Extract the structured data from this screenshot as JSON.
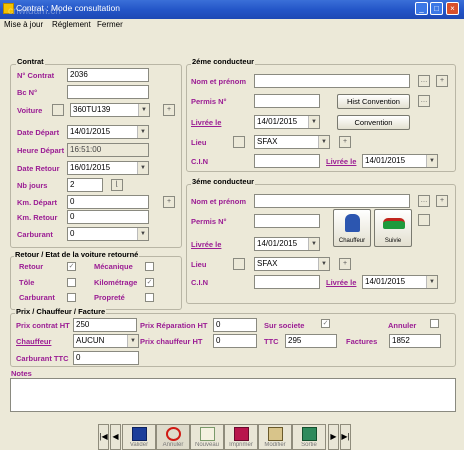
{
  "window": {
    "title": "Contrat : Mode consultation",
    "watermark": "cnwidam.ch"
  },
  "menu": [
    "Mise à jour",
    "Réglement",
    "Fermer"
  ],
  "contrat": {
    "title": "Contrat",
    "labels": {
      "n_contrat": "N° Contrat",
      "bc": "Bc N°",
      "voiture": "Voiture",
      "date_depart": "Date Départ",
      "heure_depart": "Heure Départ",
      "date_retour": "Date Retour",
      "nb_jours": "Nb jours",
      "km_depart": "Km. Départ",
      "km_retour": "Km. Retour",
      "carburant": "Carburant"
    },
    "values": {
      "n_contrat": "2036",
      "bc": "",
      "voiture": "360TU139",
      "date_depart": "14/01/2015",
      "heure_depart": "16:51:00",
      "date_retour": "16/01/2015",
      "nb_jours": "2",
      "km_depart": "0",
      "km_retour": "0",
      "carburant": "0"
    }
  },
  "retour": {
    "title": "Retour / Etat de la voiture  retourné",
    "labels": {
      "retour": "Retour",
      "mecanique": "Mécanique",
      "tole": "Tôle",
      "kilometrage": "Kilométrage",
      "carburant": "Carburant",
      "proprete": "Propreté"
    },
    "checks": {
      "retour": true,
      "mecanique": false,
      "tole": false,
      "kilometrage": true,
      "carburant": false,
      "proprete": false
    }
  },
  "conducteur2": {
    "title": "2éme conducteur",
    "labels": {
      "nom": "Nom et prénom",
      "permis": "Permis N°",
      "livree": "Livrée le",
      "lieu": "Lieu",
      "cin": "C.I.N",
      "livree2": "Livrée le"
    },
    "values": {
      "nom": "",
      "permis": "",
      "livree": "14/01/2015",
      "lieu": "SFAX",
      "cin": "",
      "livree2": "14/01/2015"
    },
    "buttons": {
      "hist": "Hist Convention",
      "convention": "Convention"
    }
  },
  "conducteur3": {
    "title": "3éme conducteur",
    "labels": {
      "nom": "Nom et prénom",
      "permis": "Permis N°",
      "livree": "Livrée le",
      "lieu": "Lieu",
      "cin": "C.I.N",
      "livree2": "Livrée le"
    },
    "values": {
      "nom": "",
      "permis": "",
      "livree": "14/01/2015",
      "lieu": "SFAX",
      "cin": "",
      "livree2": "14/01/2015"
    },
    "buttons": {
      "chauffeur": "Chauffeur",
      "suivie": "Suivie"
    }
  },
  "prix": {
    "title": "Prix / Chauffeur / Facture",
    "labels": {
      "prix_contrat": "Prix contrat HT",
      "prix_reparation": "Prix Réparation HT",
      "sur_societe": "Sur societe",
      "annuler": "Annuler",
      "chauffeur": "Chauffeur",
      "prix_chauffeur": "Prix chauffeur HT",
      "ttc": "TTC",
      "factures": "Factures",
      "carburant_ttc": "Carburant TTC"
    },
    "values": {
      "prix_contrat": "250",
      "prix_reparation": "0",
      "chauffeur": "AUCUN",
      "prix_chauffeur": "0",
      "ttc": "295",
      "factures": "1852",
      "carburant_ttc": "0"
    },
    "checks": {
      "sur_societe": true,
      "annuler": false
    }
  },
  "notes": {
    "label": "Notes",
    "value": ""
  },
  "toolbar": [
    "Valider",
    "Annuler",
    "Nouveau",
    "Imprimer",
    "Modifier",
    "Sortie"
  ]
}
